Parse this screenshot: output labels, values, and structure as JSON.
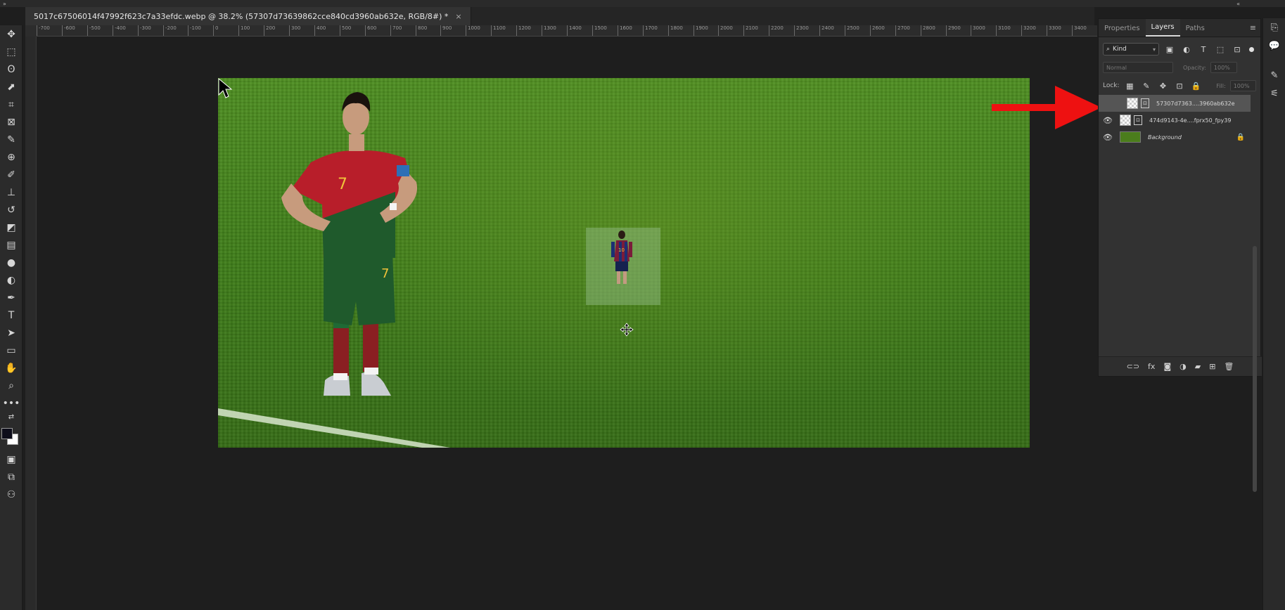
{
  "document": {
    "tab_title": "5017c67506014f47992f623c7a33efdc.webp @ 38.2% (57307d73639862cce840cd3960ab632e, RGB/8#) *",
    "close_glyph": "×"
  },
  "window_toggles": {
    "left": "»",
    "right": "«"
  },
  "ruler_labels": [
    "-700",
    "-600",
    "-500",
    "-400",
    "-300",
    "-200",
    "-100",
    "0",
    "100",
    "200",
    "300",
    "400",
    "500",
    "600",
    "700",
    "800",
    "900",
    "1000",
    "1100",
    "1200",
    "1300",
    "1400",
    "1500",
    "1600",
    "1700",
    "1800",
    "1900",
    "2000",
    "2100",
    "2200",
    "2300",
    "2400",
    "2500",
    "2600",
    "2700",
    "2800",
    "2900",
    "3000",
    "3100",
    "3200",
    "3300",
    "3400"
  ],
  "toolbar": {
    "tools": [
      {
        "name": "move-tool",
        "glyph": "✥"
      },
      {
        "name": "marquee-tool",
        "glyph": "⬚"
      },
      {
        "name": "lasso-tool",
        "glyph": "ʘ"
      },
      {
        "name": "object-select-tool",
        "glyph": "⬈"
      },
      {
        "name": "crop-tool",
        "glyph": "⌗"
      },
      {
        "name": "frame-tool",
        "glyph": "⊠"
      },
      {
        "name": "eyedropper-tool",
        "glyph": "✎"
      },
      {
        "name": "healing-tool",
        "glyph": "⊕"
      },
      {
        "name": "brush-tool",
        "glyph": "✐"
      },
      {
        "name": "stamp-tool",
        "glyph": "⊥"
      },
      {
        "name": "history-brush-tool",
        "glyph": "↺"
      },
      {
        "name": "eraser-tool",
        "glyph": "◩"
      },
      {
        "name": "gradient-tool",
        "glyph": "▤"
      },
      {
        "name": "blur-tool",
        "glyph": "●"
      },
      {
        "name": "dodge-tool",
        "glyph": "◐"
      },
      {
        "name": "pen-tool",
        "glyph": "✒"
      },
      {
        "name": "type-tool",
        "glyph": "T"
      },
      {
        "name": "path-select-tool",
        "glyph": "➤"
      },
      {
        "name": "shape-tool",
        "glyph": "▭"
      },
      {
        "name": "hand-tool",
        "glyph": "✋"
      },
      {
        "name": "zoom-tool",
        "glyph": "⌕"
      },
      {
        "name": "more-tools",
        "glyph": "•••"
      }
    ],
    "swap_glyph": "⇄",
    "bottom_tools": [
      {
        "name": "quick-mask-button",
        "glyph": "▣"
      },
      {
        "name": "screen-mode-button",
        "glyph": "⧉"
      },
      {
        "name": "share-button",
        "glyph": "⚇"
      }
    ]
  },
  "panel": {
    "tabs": [
      "Properties",
      "Layers",
      "Paths"
    ],
    "active_tab": "Layers",
    "menu_glyph": "≡",
    "filter": {
      "kind_label": "Kind",
      "icons": [
        {
          "name": "filter-pixel-icon",
          "glyph": "▣"
        },
        {
          "name": "filter-adjustment-icon",
          "glyph": "◐"
        },
        {
          "name": "filter-type-icon",
          "glyph": "T"
        },
        {
          "name": "filter-shape-icon",
          "glyph": "⬚"
        },
        {
          "name": "filter-smart-object-icon",
          "glyph": "⊡"
        }
      ]
    },
    "blend_mode": "Normal",
    "opacity_label": "Opacity:",
    "opacity_value": "100%",
    "lock_label": "Lock:",
    "lock_icons": [
      {
        "name": "lock-transparent-icon",
        "glyph": "▦"
      },
      {
        "name": "lock-image-icon",
        "glyph": "✎"
      },
      {
        "name": "lock-position-icon",
        "glyph": "✥"
      },
      {
        "name": "lock-artboard-icon",
        "glyph": "⊡"
      },
      {
        "name": "lock-all-icon",
        "glyph": "🔒"
      }
    ],
    "fill_label": "Fill:",
    "fill_value": "100%",
    "layers": [
      {
        "name": "57307d7363....3960ab632e",
        "visible": false,
        "selected": true,
        "type": "smart"
      },
      {
        "name": "474d9143-4e....fprx50_fpy39",
        "visible": true,
        "selected": false,
        "type": "smart"
      },
      {
        "name": "Background",
        "visible": true,
        "selected": false,
        "type": "background",
        "locked": true
      }
    ],
    "eye_glyph": "👁",
    "lock_glyph": "🔒",
    "footer_icons": [
      {
        "name": "link-layers-icon",
        "glyph": "⊂⊃"
      },
      {
        "name": "fx-icon",
        "glyph": "fx"
      },
      {
        "name": "add-mask-icon",
        "glyph": "◙"
      },
      {
        "name": "adjustment-layer-icon",
        "glyph": "◑"
      },
      {
        "name": "new-group-icon",
        "glyph": "▰"
      },
      {
        "name": "new-layer-icon",
        "glyph": "⊞"
      },
      {
        "name": "delete-layer-icon",
        "glyph": "🗑"
      }
    ]
  },
  "side_strip": [
    {
      "name": "history-panel-icon",
      "glyph": "⎘"
    },
    {
      "name": "comments-icon",
      "glyph": "💬"
    },
    {
      "name": "brushes-panel-icon",
      "glyph": "✎"
    },
    {
      "name": "adjustments-panel-icon",
      "glyph": "⚟"
    }
  ],
  "colors": {
    "annotation_arrow": "#ee1111",
    "jersey_red": "#b81e2a",
    "jersey_green": "#1f5a2c"
  }
}
